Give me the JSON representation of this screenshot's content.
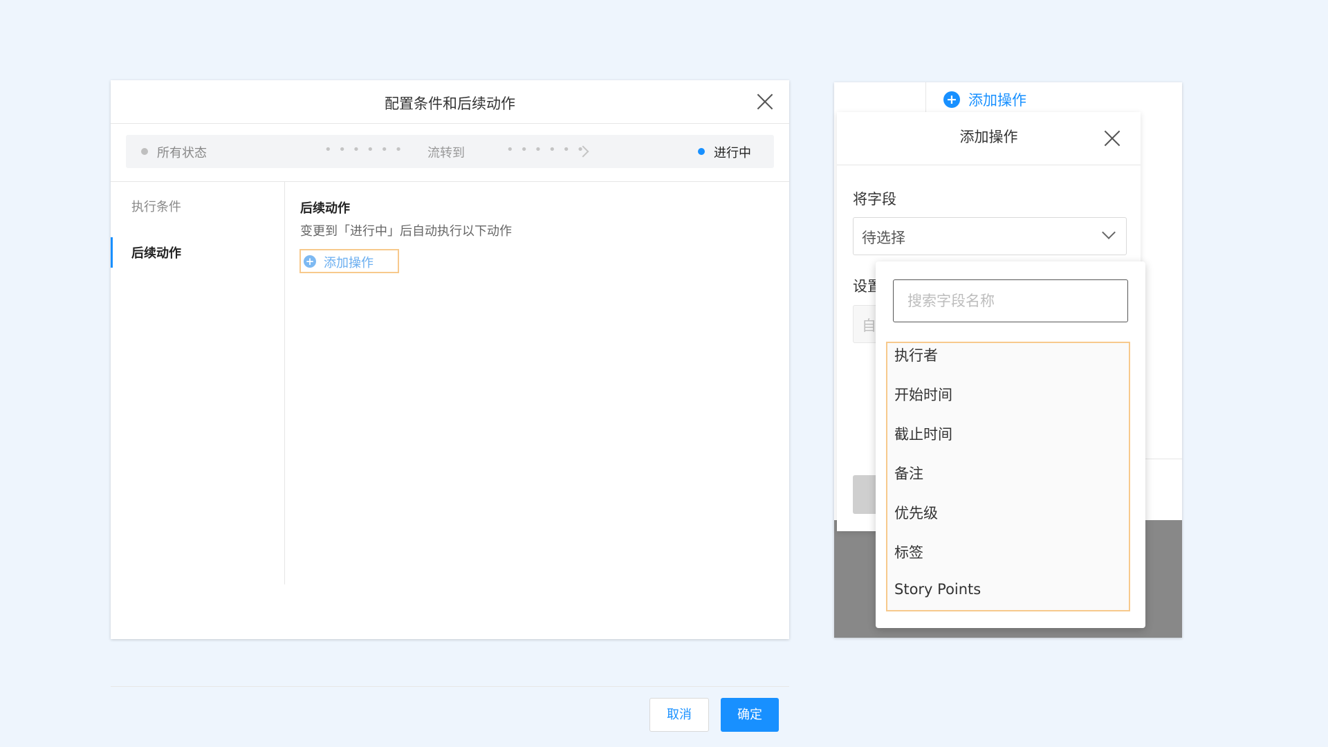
{
  "left_dialog": {
    "title": "配置条件和后续动作",
    "flow": {
      "from": "所有状态",
      "dots": "• • • • • •",
      "middle": "流转到",
      "to": "进行中"
    },
    "sidebar": [
      {
        "label": "执行条件"
      },
      {
        "label": "后续动作"
      }
    ],
    "main": {
      "title": "后续动作",
      "description": "变更到「进行中」后自动执行以下动作",
      "add_label": "添加操作"
    },
    "footer": {
      "cancel_label": "取消",
      "ok_label": "确定"
    }
  },
  "right_panel": {
    "top_add_label": "添加操作",
    "sub_dialog": {
      "title": "添加操作",
      "field_label": "将字段",
      "field_value": "待选择",
      "set_label": "设置",
      "set_value": "自"
    },
    "dropdown": {
      "search_placeholder": "搜索字段名称",
      "items": [
        "执行者",
        "开始时间",
        "截止时间",
        "备注",
        "优先级",
        "标签",
        "Story Points"
      ]
    }
  },
  "colors": {
    "accent": "#1890ff",
    "highlight_border": "#f7c98c",
    "background": "#eef5fd"
  }
}
